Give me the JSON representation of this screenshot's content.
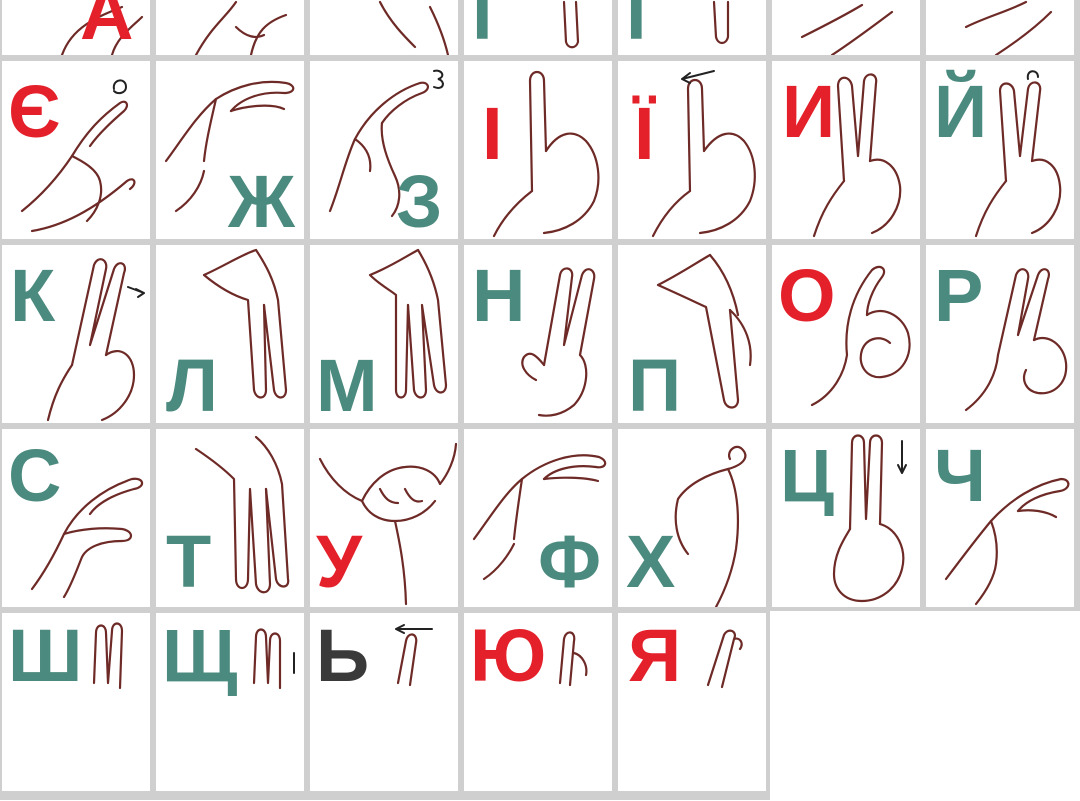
{
  "cells": [
    {
      "letter": "А",
      "color": "#e4202a",
      "icon": "hand-sign-a-icon"
    },
    {
      "letter": "",
      "color": "#4b8a7e",
      "icon": "hand-sign-b-icon"
    },
    {
      "letter": "",
      "color": "#4b8a7e",
      "icon": "hand-sign-v-icon"
    },
    {
      "letter": "Г",
      "color": "#4b8a7e",
      "icon": "hand-sign-g-icon"
    },
    {
      "letter": "Ґ",
      "color": "#4b8a7e",
      "icon": "hand-sign-gh-icon"
    },
    {
      "letter": "",
      "color": "#4b8a7e",
      "icon": "hand-sign-d-icon"
    },
    {
      "letter": "",
      "color": "#4b8a7e",
      "icon": "hand-sign-e-icon"
    },
    {
      "letter": "Є",
      "color": "#e4202a",
      "icon": "hand-sign-ye-icon"
    },
    {
      "letter": "Ж",
      "color": "#4b8a7e",
      "icon": "hand-sign-zh-icon"
    },
    {
      "letter": "З",
      "color": "#4b8a7e",
      "icon": "hand-sign-z-icon"
    },
    {
      "letter": "І",
      "color": "#e4202a",
      "icon": "hand-sign-i-icon"
    },
    {
      "letter": "Ї",
      "color": "#e4202a",
      "icon": "hand-sign-yi-icon"
    },
    {
      "letter": "И",
      "color": "#e4202a",
      "icon": "hand-sign-y-icon"
    },
    {
      "letter": "Й",
      "color": "#4b8a7e",
      "icon": "hand-sign-short-i-icon"
    },
    {
      "letter": "К",
      "color": "#4b8a7e",
      "icon": "hand-sign-k-icon"
    },
    {
      "letter": "Л",
      "color": "#4b8a7e",
      "icon": "hand-sign-l-icon"
    },
    {
      "letter": "М",
      "color": "#4b8a7e",
      "icon": "hand-sign-m-icon"
    },
    {
      "letter": "Н",
      "color": "#4b8a7e",
      "icon": "hand-sign-n-icon"
    },
    {
      "letter": "П",
      "color": "#4b8a7e",
      "icon": "hand-sign-p-icon"
    },
    {
      "letter": "О",
      "color": "#e4202a",
      "icon": "hand-sign-o-icon"
    },
    {
      "letter": "Р",
      "color": "#4b8a7e",
      "icon": "hand-sign-r-icon"
    },
    {
      "letter": "С",
      "color": "#4b8a7e",
      "icon": "hand-sign-s-icon"
    },
    {
      "letter": "Т",
      "color": "#4b8a7e",
      "icon": "hand-sign-t-icon"
    },
    {
      "letter": "У",
      "color": "#e4202a",
      "icon": "hand-sign-u-icon"
    },
    {
      "letter": "Ф",
      "color": "#4b8a7e",
      "icon": "hand-sign-f-icon"
    },
    {
      "letter": "Х",
      "color": "#4b8a7e",
      "icon": "hand-sign-kh-icon"
    },
    {
      "letter": "Ц",
      "color": "#4b8a7e",
      "icon": "hand-sign-ts-icon"
    },
    {
      "letter": "Ч",
      "color": "#4b8a7e",
      "icon": "hand-sign-ch-icon"
    },
    {
      "letter": "Ш",
      "color": "#4b8a7e",
      "icon": "hand-sign-sh-icon"
    },
    {
      "letter": "Щ",
      "color": "#4b8a7e",
      "icon": "hand-sign-shch-icon"
    },
    {
      "letter": "Ь",
      "color": "#3a3a3a",
      "icon": "hand-sign-soft-sign-icon"
    },
    {
      "letter": "Ю",
      "color": "#e4202a",
      "icon": "hand-sign-yu-icon"
    },
    {
      "letter": "Я",
      "color": "#e4202a",
      "icon": "hand-sign-ya-icon"
    }
  ]
}
